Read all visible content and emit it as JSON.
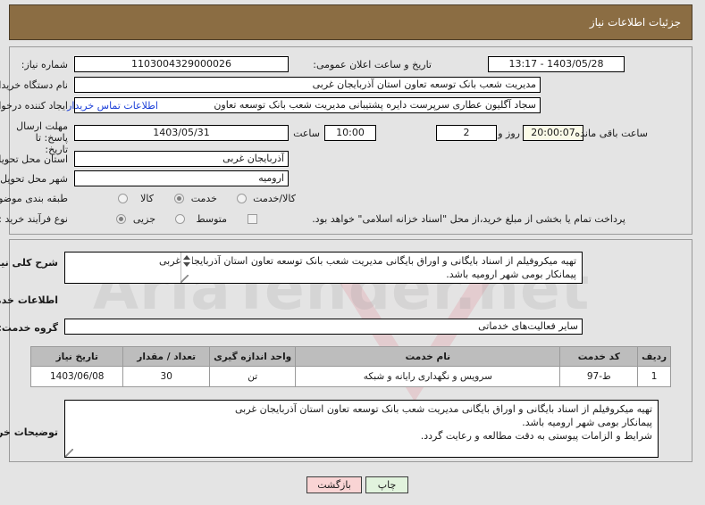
{
  "header": {
    "title": "جزئیات اطلاعات نیاز"
  },
  "form": {
    "need_number": {
      "label": "شماره نیاز:",
      "value": "1103004329000026"
    },
    "public_announce": {
      "label": "تاریخ و ساعت اعلان عمومی:",
      "value": "1403/05/28 - 13:17"
    },
    "buyer_org": {
      "label": "نام دستگاه خریدار:",
      "value": "مدیریت شعب بانک توسعه تعاون استان آذربایجان غربی"
    },
    "requester": {
      "label": "ایجاد کننده درخواست:",
      "value": "سجاد آگلیون عطاری سرپرست دایره پشتیبانی مدیریت شعب بانک توسعه تعاون"
    },
    "contact_link": "اطلاعات تماس خریدار",
    "deadline": {
      "label": "مهلت ارسال پاسخ: تا تاریخ:",
      "date": "1403/05/31",
      "hour_label": "ساعت",
      "hour": "10:00",
      "days": "2",
      "days_label": "روز و",
      "remaining": "20:00:07",
      "remaining_label": "ساعت باقی مانده"
    },
    "province": {
      "label": "استان محل تحویل:",
      "value": "آذربایجان غربی"
    },
    "city": {
      "label": "شهر محل تحویل:",
      "value": "ارومیه"
    },
    "subject_class": {
      "label": "طبقه بندی موضوعی:",
      "options": [
        "کالا",
        "خدمت",
        "کالا/خدمت"
      ],
      "selected": "خدمت"
    },
    "process_type": {
      "label": "نوع فرآیند خرید :",
      "options": [
        "جزیی",
        "متوسط"
      ],
      "selected": "جزیی"
    },
    "treasury_note": {
      "text": "پرداخت تمام یا بخشی از مبلغ خرید،از محل \"اسناد خزانه اسلامی\" خواهد بود.",
      "checked": false
    }
  },
  "need_summary": {
    "label": "شرح کلی نیاز:",
    "lines": [
      "تهیه میکروفیلم از اسناد بایگانی و اوراق بایگانی مدیریت شعب بانک توسعه تعاون استان آذربایجان غربی",
      "پیمانکار بومی شهر ارومیه باشد."
    ]
  },
  "services_section": {
    "title": "اطلاعات خدمات مورد نیاز"
  },
  "service_group": {
    "label": "گروه خدمت:",
    "value": "سایر فعالیت‌های خدماتی"
  },
  "table": {
    "columns": [
      "ردیف",
      "کد خدمت",
      "نام خدمت",
      "واحد اندازه گیری",
      "تعداد / مقدار",
      "تاریخ نیاز"
    ],
    "rows": [
      {
        "row": "1",
        "code": "ط-97",
        "name": "سرویس و نگهداری رایانه و شبکه",
        "unit": "تن",
        "qty": "30",
        "date": "1403/06/08"
      }
    ]
  },
  "buyer_notes": {
    "label": "توضیحات خریدار:",
    "lines": [
      "تهیه میکروفیلم از اسناد بایگانی و اوراق بایگانی مدیریت شعب بانک توسعه تعاون استان آذربایجان غربی",
      "پیمانکار بومی شهر ارومیه باشد.",
      "شرایط و الزامات پیوستی به دقت مطالعه و رعایت گردد."
    ]
  },
  "actions": {
    "back": "بازگشت",
    "print": "چاپ"
  },
  "watermark": {
    "text": "AriaTender.net"
  },
  "colors": {
    "header_bg": "#8b6d43",
    "page_bg": "#e4e4e4",
    "link": "#1b3fd8",
    "back_btn": "#f9d4d4",
    "print_btn": "#e1f3dd",
    "table_header": "#bdbdbd"
  }
}
